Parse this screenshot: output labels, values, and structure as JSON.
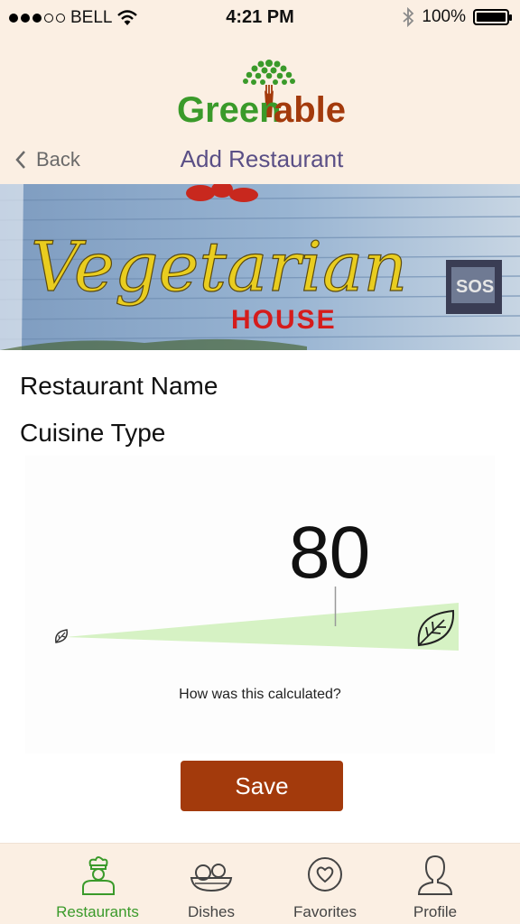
{
  "status_bar": {
    "carrier": "BELL",
    "time": "4:21 PM",
    "battery": "100%"
  },
  "header": {
    "logo_text": "GreenTable",
    "back_label": "Back",
    "title": "Add Restaurant"
  },
  "hero": {
    "sign_text_script": "Vegetarian",
    "sign_text_block": "HOUSE"
  },
  "form": {
    "restaurant_name_label": "Restaurant Name",
    "cuisine_type_label": "Cuisine Type"
  },
  "score": {
    "value": "80",
    "level": 0.8,
    "calc_link": "How was this calculated?"
  },
  "actions": {
    "save_label": "Save"
  },
  "tabs": [
    {
      "label": "Restaurants",
      "icon": "chef-icon",
      "active": true
    },
    {
      "label": "Dishes",
      "icon": "bowl-icon",
      "active": false
    },
    {
      "label": "Favorites",
      "icon": "heart-icon",
      "active": false
    },
    {
      "label": "Profile",
      "icon": "person-icon",
      "active": false
    }
  ],
  "colors": {
    "accent_green": "#3a9a2a",
    "save_button": "#a33a0c",
    "header_bg": "#fbefe3",
    "nav_title": "#5a4f86",
    "meter_fill": "#d6f2c4"
  }
}
